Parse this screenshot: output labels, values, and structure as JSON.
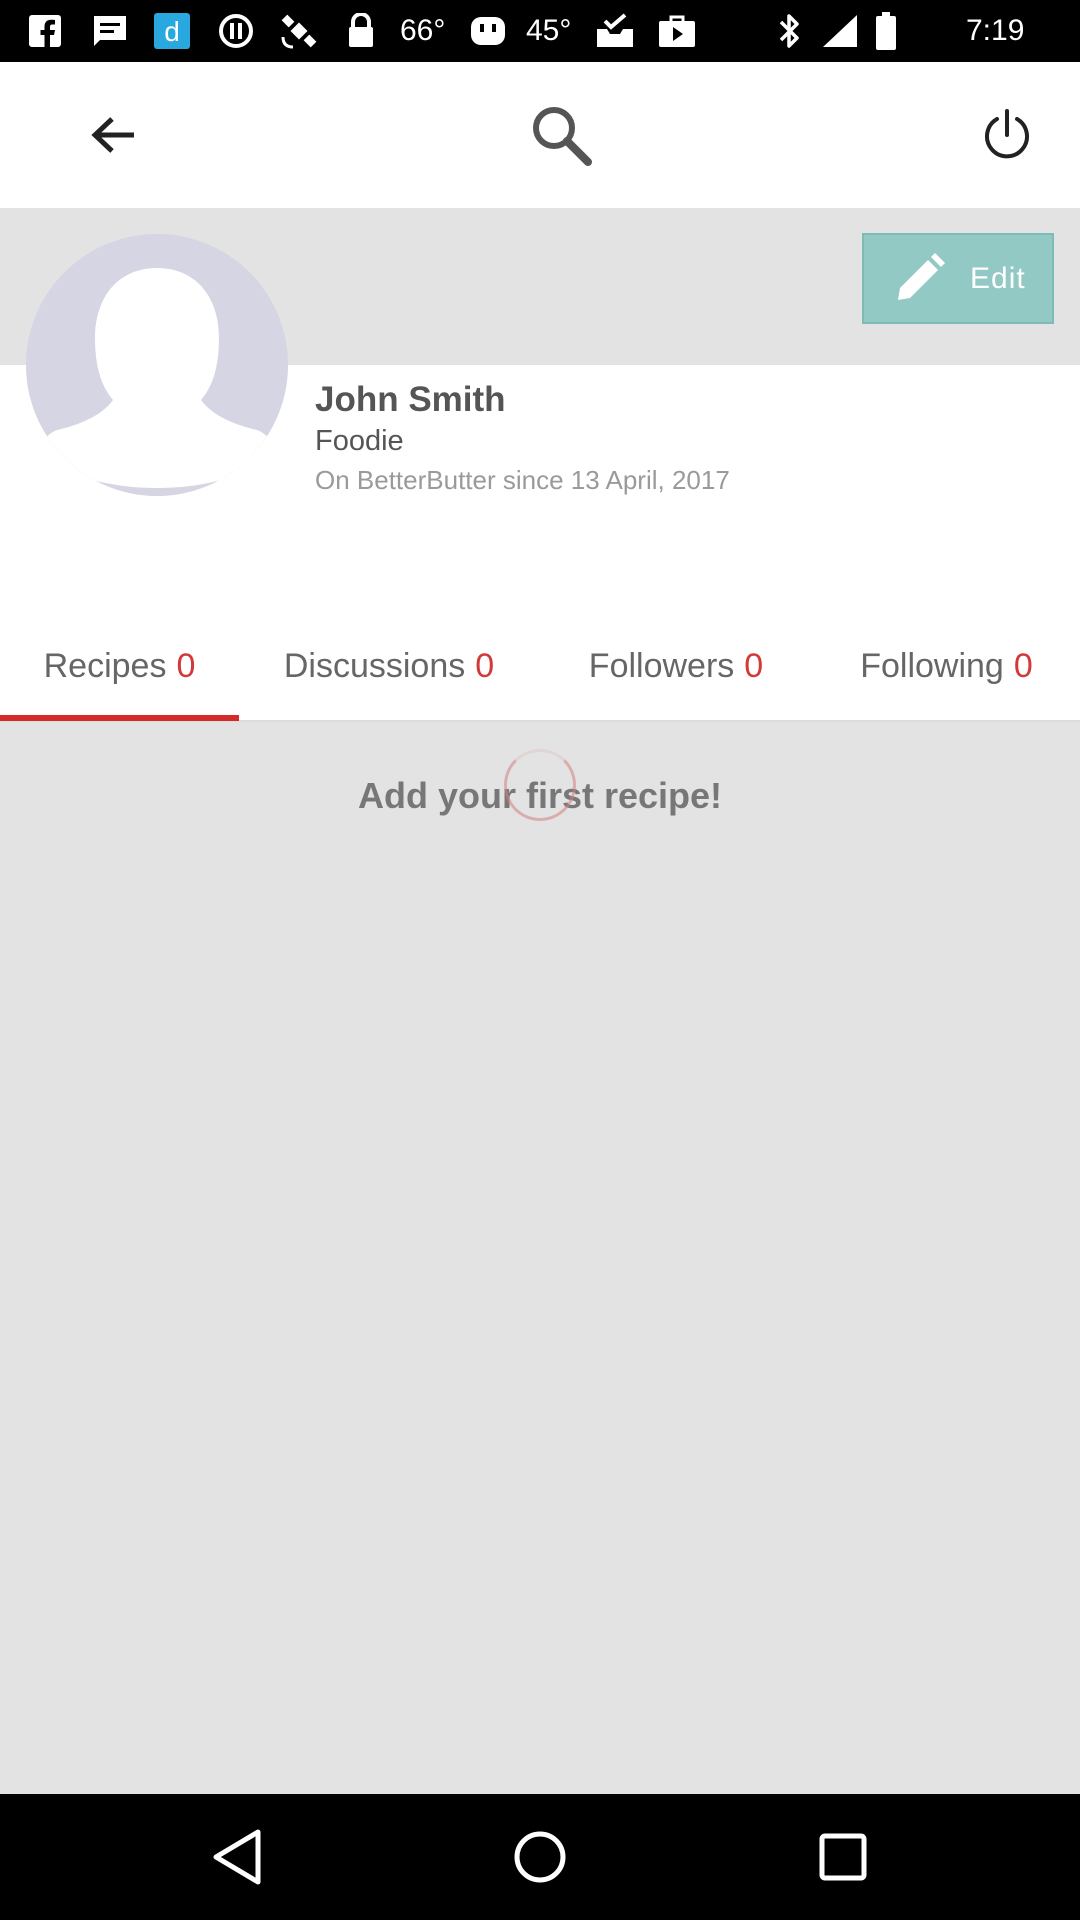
{
  "status_bar": {
    "temp_1": "66°",
    "temp_2": "45°",
    "time": "7:19"
  },
  "toolbar": {
    "back_icon": "arrow-back-icon",
    "search_icon": "search-icon",
    "power_icon": "power-icon"
  },
  "profile": {
    "name": "John Smith",
    "role": "Foodie",
    "since": "On BetterButter since 13 April, 2017",
    "edit_label": "Edit"
  },
  "tabs": [
    {
      "label": "Recipes",
      "count": "0",
      "active": true
    },
    {
      "label": "Discussions",
      "count": "0",
      "active": false
    },
    {
      "label": "Followers",
      "count": "0",
      "active": false
    },
    {
      "label": "Following",
      "count": "0",
      "active": false
    }
  ],
  "content": {
    "empty_message": "Add your first recipe!"
  },
  "colors": {
    "accent_red": "#d42a2a",
    "edit_button": "#93c9c4",
    "band_gray": "#e3e3e3"
  }
}
